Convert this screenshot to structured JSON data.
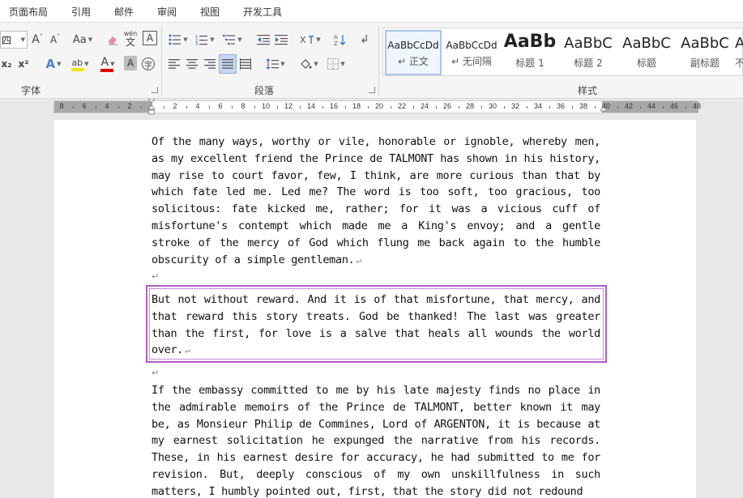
{
  "menu": {
    "tabs": [
      "页面布局",
      "引用",
      "邮件",
      "审阅",
      "视图",
      "开发工具"
    ]
  },
  "ribbon": {
    "font_group": {
      "label": "字体",
      "font_size": "四",
      "grow_font": "A",
      "shrink_font": "A",
      "change_case": "Aa",
      "phonetic_top": "wén",
      "phonetic_bottom": "文",
      "char_border": "A",
      "subscript": "x₂",
      "superscript": "x²",
      "text_effect": "A",
      "highlight": "ab",
      "font_color": "A",
      "char_shading": "A",
      "enclose_char": "字",
      "highlight_color": "#f5e600",
      "font_color_value": "#e00000"
    },
    "paragraph_group": {
      "label": "段落"
    },
    "styles_group": {
      "label": "样式",
      "items": [
        {
          "sample": "AaBbCcDd",
          "name": "↵ 正文",
          "selected": true
        },
        {
          "sample": "AaBbCcDd",
          "name": "↵ 无间隔",
          "selected": false
        },
        {
          "sample": "AaBb",
          "name": "标题 1",
          "selected": false
        },
        {
          "sample": "AaBbC",
          "name": "标题 2",
          "selected": false
        },
        {
          "sample": "AaBbC",
          "name": "标题",
          "selected": false
        },
        {
          "sample": "AaBbC",
          "name": "副标题",
          "selected": false
        },
        {
          "sample": "A",
          "name": "不",
          "selected": false
        }
      ]
    }
  },
  "ruler": {
    "left_numbers": [
      "8",
      "6",
      "4",
      "2"
    ],
    "right_numbers": [
      "2",
      "4",
      "6",
      "8",
      "10",
      "12",
      "14",
      "16",
      "18",
      "20",
      "22",
      "24",
      "26",
      "28",
      "30",
      "32",
      "34",
      "36",
      "38",
      "40",
      "42",
      "44",
      "46",
      "48"
    ]
  },
  "document": {
    "paragraph_mark": "↵",
    "paragraphs": [
      "Of the many ways, worthy or vile, honorable or ignoble, whereby men, as my excellent friend the Prince de TALMONT has shown in his history, may rise to court favor, few, I think, are more curious than that by which fate led me. Led me? The word is too soft, too gracious, too solicitous: fate kicked me, rather; for it was a vicious cuff of misfortune's contempt which made me a King's envoy; and a gentle stroke of the mercy of God which flung me back again to the humble obscurity of a simple gentleman.",
      "But not without reward. And it is of that misfortune, that mercy, and that reward this story treats. God be thanked! The last was greater than the first, for love is a salve that heals all wounds the world over.",
      "If the embassy committed to me by his late majesty finds no place in the admirable memoirs of the Prince de TALMONT, better known it may be, as Monsieur Philip de Commines, Lord of ARGENTON, it is because at my earnest solicitation he expunged the narrative from his records. These, in his earnest desire for accuracy, he had submitted to me for revision. But, deeply conscious of my own unskillfulness in such matters, I humbly pointed out, first, that the story did not redound"
    ]
  }
}
